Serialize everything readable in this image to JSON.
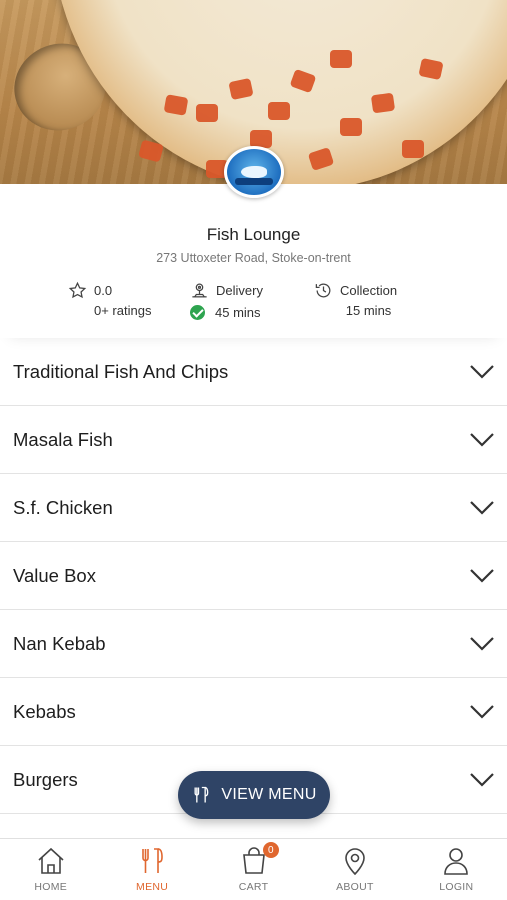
{
  "restaurant": {
    "name": "Fish Lounge",
    "address": "273 Uttoxeter Road, Stoke-on-trent"
  },
  "stats": {
    "rating_value": "0.0",
    "rating_count": "0+ ratings",
    "delivery_label": "Delivery",
    "delivery_time": "45 mins",
    "collection_label": "Collection",
    "collection_time": "15 mins"
  },
  "categories": [
    {
      "label": "Traditional Fish And Chips"
    },
    {
      "label": "Masala Fish"
    },
    {
      "label": "S.f. Chicken"
    },
    {
      "label": "Value Box"
    },
    {
      "label": "Nan Kebab"
    },
    {
      "label": "Kebabs"
    },
    {
      "label": "Burgers"
    }
  ],
  "view_menu_button": "VIEW MENU",
  "bottom_nav": {
    "home": "HOME",
    "menu": "MENU",
    "cart": "CART",
    "cart_count": "0",
    "about": "ABOUT",
    "login": "LOGIN"
  },
  "colors": {
    "accent": "#e0672f",
    "button": "#2f4466",
    "success": "#2ea44f"
  }
}
